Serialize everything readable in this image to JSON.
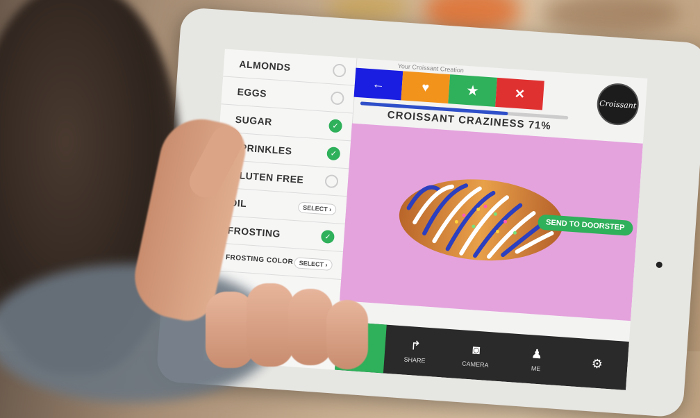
{
  "options": [
    {
      "label": "ALMONDS",
      "control": "check",
      "checked": false
    },
    {
      "label": "EGGS",
      "control": "check",
      "checked": false
    },
    {
      "label": "SUGAR",
      "control": "check",
      "checked": true
    },
    {
      "label": "SPRINKLES",
      "control": "check",
      "checked": true
    },
    {
      "label": "GLUTEN FREE",
      "control": "check",
      "checked": false
    },
    {
      "label": "OIL",
      "control": "select",
      "select_label": "SELECT ›"
    },
    {
      "label": "FROSTING",
      "control": "check",
      "checked": true
    },
    {
      "label": "FROSTING COLOR",
      "control": "select",
      "select_label": "SELECT ›"
    }
  ],
  "header": {
    "subtitle": "Your Croissant Creation",
    "logo_text": "Croissant"
  },
  "actions": [
    {
      "name": "back",
      "icon": "arrow-left-icon",
      "glyph": "←",
      "color": "#1a1ee0"
    },
    {
      "name": "favorite",
      "icon": "heart-icon",
      "glyph": "♥",
      "color": "#f2931c"
    },
    {
      "name": "star",
      "icon": "star-icon",
      "glyph": "★",
      "color": "#2fb05a"
    },
    {
      "name": "close",
      "icon": "close-icon",
      "glyph": "✕",
      "color": "#e03131"
    }
  ],
  "craziness": {
    "label": "CROISSANT CRAZINESS 71%",
    "value": 0.71
  },
  "send_button": "SEND TO DOORSTEP",
  "tabs": [
    {
      "name": "home",
      "icon": "home-icon",
      "glyph": "⌂",
      "label": ""
    },
    {
      "name": "share",
      "icon": "share-icon",
      "glyph": "↱",
      "label": "SHARE"
    },
    {
      "name": "camera",
      "icon": "camera-icon",
      "glyph": "◙",
      "label": "CAMERA"
    },
    {
      "name": "me",
      "icon": "person-icon",
      "glyph": "♟",
      "label": "ME"
    },
    {
      "name": "settings",
      "icon": "gear-icon",
      "glyph": "⚙",
      "label": ""
    }
  ],
  "colors": {
    "green": "#2fb05a",
    "canvas": "#e4a3dd",
    "tabbar": "#2a2a2a"
  }
}
